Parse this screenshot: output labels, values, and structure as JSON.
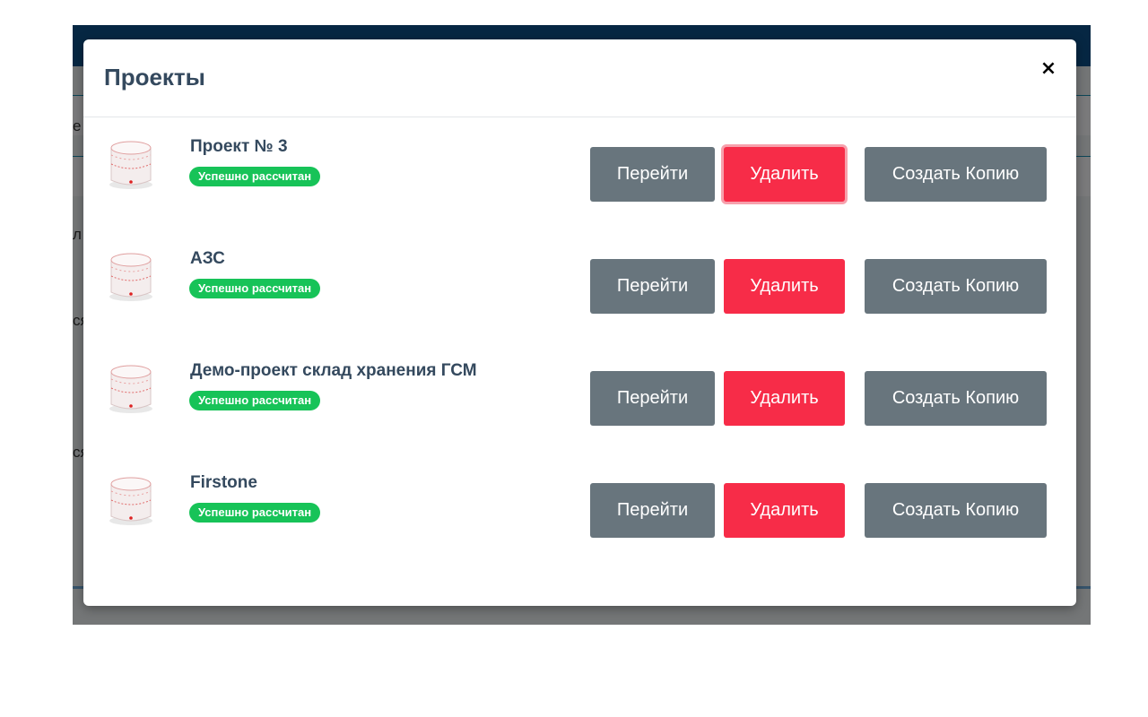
{
  "modal": {
    "title": "Проекты",
    "close_label": "×"
  },
  "background_fragments": [
    "е",
    "л",
    "ся",
    "ся"
  ],
  "projects": [
    {
      "name": "Проект № 3",
      "status": "Успешно рассчитан",
      "go_label": "Перейти",
      "delete_label": "Удалить",
      "copy_label": "Создать Копию"
    },
    {
      "name": "АЗС",
      "status": "Успешно рассчитан",
      "go_label": "Перейти",
      "delete_label": "Удалить",
      "copy_label": "Создать Копию"
    },
    {
      "name": "Демо-проект склад хранения ГСМ",
      "status": "Успешно рассчитан",
      "go_label": "Перейти",
      "delete_label": "Удалить",
      "copy_label": "Создать Копию"
    },
    {
      "name": "Firstone",
      "status": "Успешно рассчитан",
      "go_label": "Перейти",
      "delete_label": "Удалить",
      "copy_label": "Создать Копию"
    }
  ],
  "colors": {
    "go_button": "#68757d",
    "delete_button": "#f72c48",
    "status_badge": "#17c358",
    "title_text": "#34495e"
  }
}
